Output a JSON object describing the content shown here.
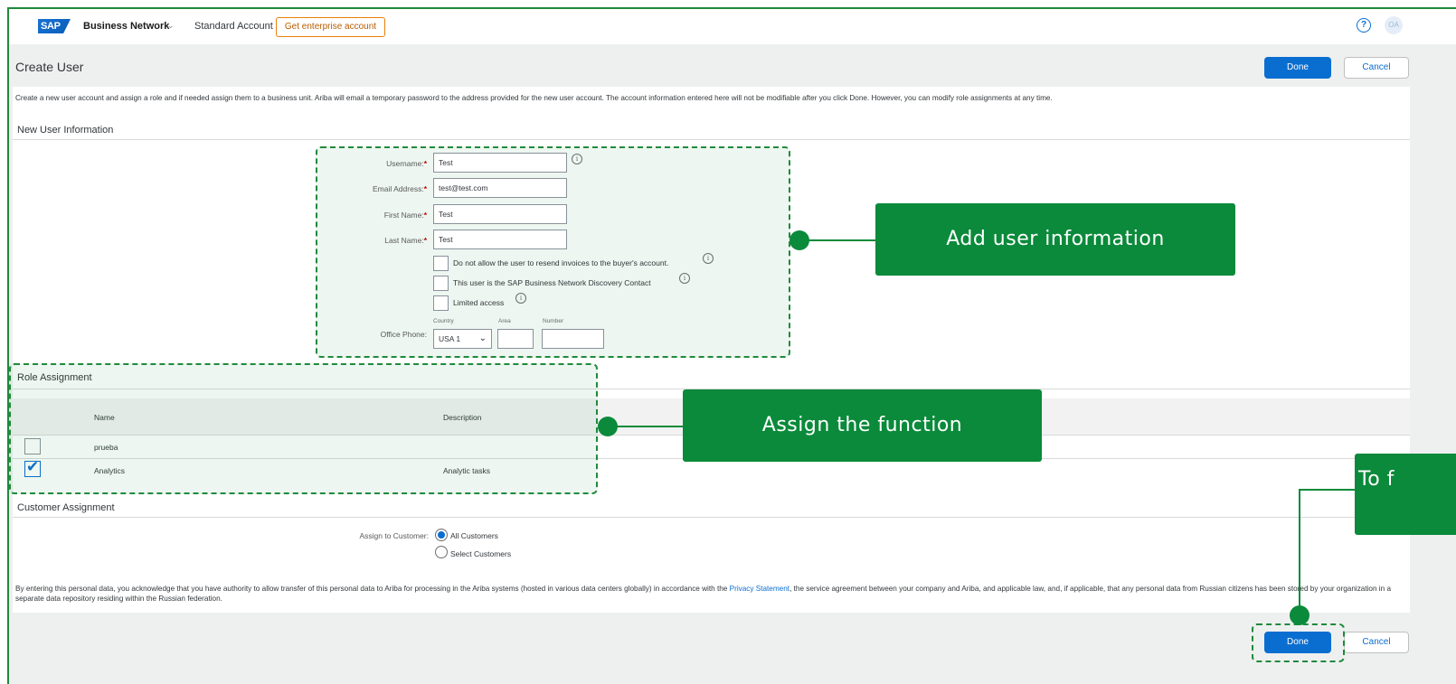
{
  "header": {
    "logo_text": "SAP",
    "brand": "Business Network",
    "brand_chevron": "⌄",
    "account": "Standard Account",
    "enterprise_button": "Get enterprise account",
    "help_icon": "?",
    "avatar": "OA"
  },
  "page": {
    "title": "Create User",
    "done_label": "Done",
    "cancel_label": "Cancel",
    "description": "Create a new user account and assign a role and if needed assign them to a business unit. Ariba will email a temporary password to the address provided for the new user account. The account information entered here will not be modifiable after you click Done. However, you can modify role assignments at any time."
  },
  "user_info": {
    "section_title": "New User Information",
    "fields": [
      {
        "label": "Username:",
        "value": "Test",
        "required": "*"
      },
      {
        "label": "Email Address:",
        "value": "test@test.com",
        "required": "*"
      },
      {
        "label": "First Name:",
        "value": "Test",
        "required": "*"
      },
      {
        "label": "Last Name:",
        "value": "Test",
        "required": "*"
      }
    ],
    "checkboxes": [
      {
        "label": "Do not allow the user to resend invoices to the buyer's account."
      },
      {
        "label": "This user is the SAP Business Network Discovery Contact"
      },
      {
        "label": "Limited access"
      }
    ],
    "info_glyph": "i",
    "phone": {
      "label": "Office Phone:",
      "country_label": "Country",
      "area_label": "Area",
      "number_label": "Number",
      "country_value": "USA 1",
      "country_chevron": "⌄",
      "area_value": "",
      "number_value": ""
    }
  },
  "role_assignment": {
    "section_title": "Role Assignment",
    "columns": [
      "Name",
      "Description"
    ],
    "rows": [
      {
        "name": "prueba",
        "description": "",
        "checked": false
      },
      {
        "name": "Analytics",
        "description": "Analytic tasks",
        "checked": true
      }
    ],
    "check_glyph": "✔"
  },
  "customer_assignment": {
    "section_title": "Customer Assignment",
    "label": "Assign to Customer:",
    "options": [
      {
        "label": "All Customers",
        "selected": true
      },
      {
        "label": "Select Customers",
        "selected": false
      }
    ]
  },
  "legal": {
    "text_before": "By entering this personal data, you acknowledge that you have authority to allow transfer of this personal data to Ariba for processing in the Ariba systems (hosted in various data centers globally) in accordance with the ",
    "link": "Privacy Statement",
    "text_after": ", the service agreement between your company and Ariba, and applicable law, and, if applicable, that any personal data from Russian citizens has been stored by your organization in a separate data repository residing within the Russian federation."
  },
  "callouts": {
    "user_info": "Add user information",
    "role": "Assign the function",
    "finish": "To f"
  },
  "colors": {
    "accent": "#0a6ed1",
    "callout_green": "#0a8a3a",
    "enterprise_orange": "#e8800a"
  }
}
